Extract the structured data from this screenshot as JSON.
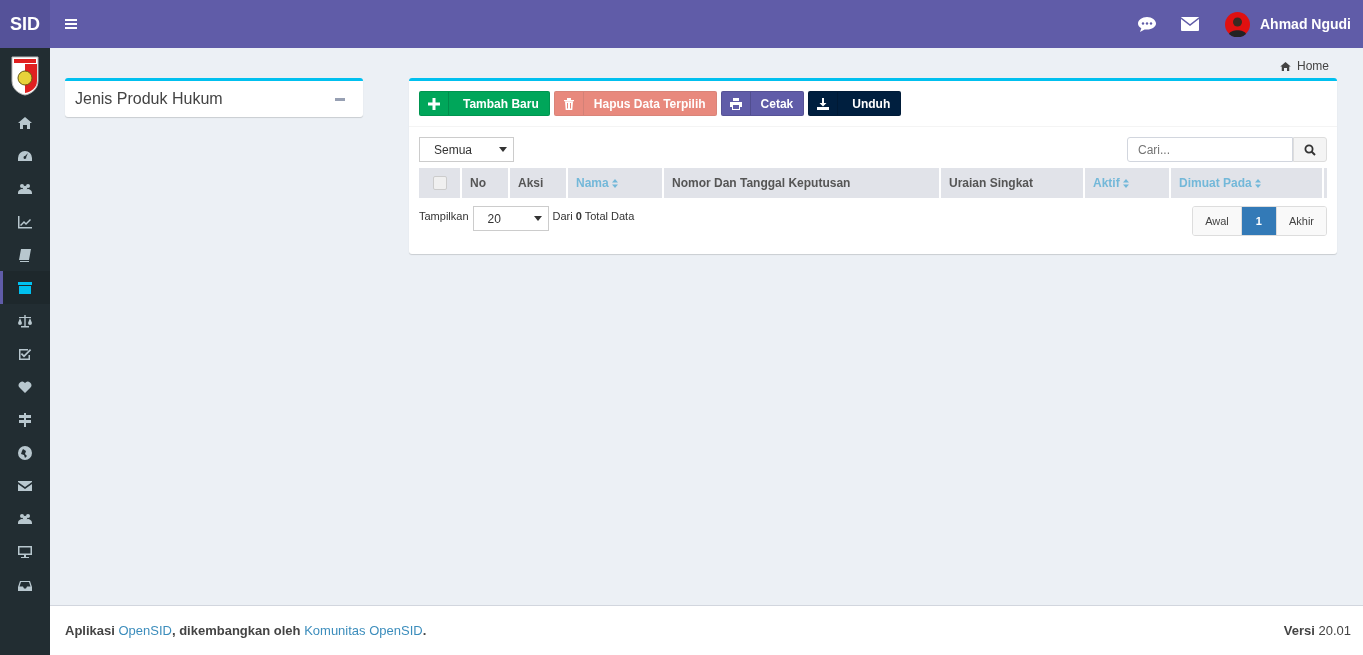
{
  "header": {
    "logo": "SID",
    "user": {
      "name": "Ahmad Ngudi"
    }
  },
  "sidebar": {
    "items": [
      {
        "kind": "home",
        "selected": false
      },
      {
        "kind": "dashboard",
        "selected": false
      },
      {
        "kind": "users",
        "selected": false
      },
      {
        "kind": "chart",
        "selected": false
      },
      {
        "kind": "book",
        "selected": false
      },
      {
        "kind": "archive",
        "selected": true
      },
      {
        "kind": "scale",
        "selected": false
      },
      {
        "kind": "check",
        "selected": false
      },
      {
        "kind": "heart",
        "selected": false
      },
      {
        "kind": "signpost",
        "selected": false
      },
      {
        "kind": "globe",
        "selected": false
      },
      {
        "kind": "envelope",
        "selected": false
      },
      {
        "kind": "users",
        "selected": false
      },
      {
        "kind": "monitor",
        "selected": false
      },
      {
        "kind": "inbox",
        "selected": false
      }
    ]
  },
  "category_box": {
    "title": "Jenis Produk Hukum"
  },
  "breadcrumb": [
    "Home"
  ],
  "toolbar": [
    {
      "kind": "add",
      "label": "Tambah Baru",
      "disabled": false
    },
    {
      "kind": "delete",
      "label": "Hapus Data Terpilih",
      "disabled": true
    },
    {
      "kind": "print",
      "label": "Cetak",
      "disabled": false
    },
    {
      "kind": "download",
      "label": "Unduh",
      "disabled": false
    }
  ],
  "filter": {
    "value": "Semua"
  },
  "search": {
    "placeholder": "Cari..."
  },
  "table": {
    "select_all": {
      "checked": false
    },
    "columns": [
      {
        "label": "No",
        "sortable": false
      },
      {
        "label": "Aksi",
        "sortable": false
      },
      {
        "label": "Nama",
        "sortable": true
      },
      {
        "label": "Nomor Dan Tanggal Keputusan",
        "sortable": false
      },
      {
        "label": "Uraian Singkat",
        "sortable": false
      },
      {
        "label": "Aktif",
        "sortable": true
      },
      {
        "label": "Dimuat Pada",
        "sortable": true
      }
    ]
  },
  "page_size": {
    "label": "Tampilkan",
    "value": "20",
    "summary": "Dari **0** Total Data"
  },
  "pagination": [
    {
      "label": "Awal",
      "selected": false
    },
    {
      "label": "1",
      "selected": true
    },
    {
      "label": "Akhir",
      "selected": false
    }
  ],
  "footer": {
    "parts": [
      {
        "kind": "bold",
        "text": "Aplikasi "
      },
      {
        "kind": "link",
        "text": "OpenSID"
      },
      {
        "kind": "bold",
        "text": ", dikembangkan oleh "
      },
      {
        "kind": "link",
        "text": "Komunitas OpenSID"
      },
      {
        "kind": "bold",
        "text": "."
      }
    ],
    "version_label": "Versi",
    "version": "20.01"
  }
}
